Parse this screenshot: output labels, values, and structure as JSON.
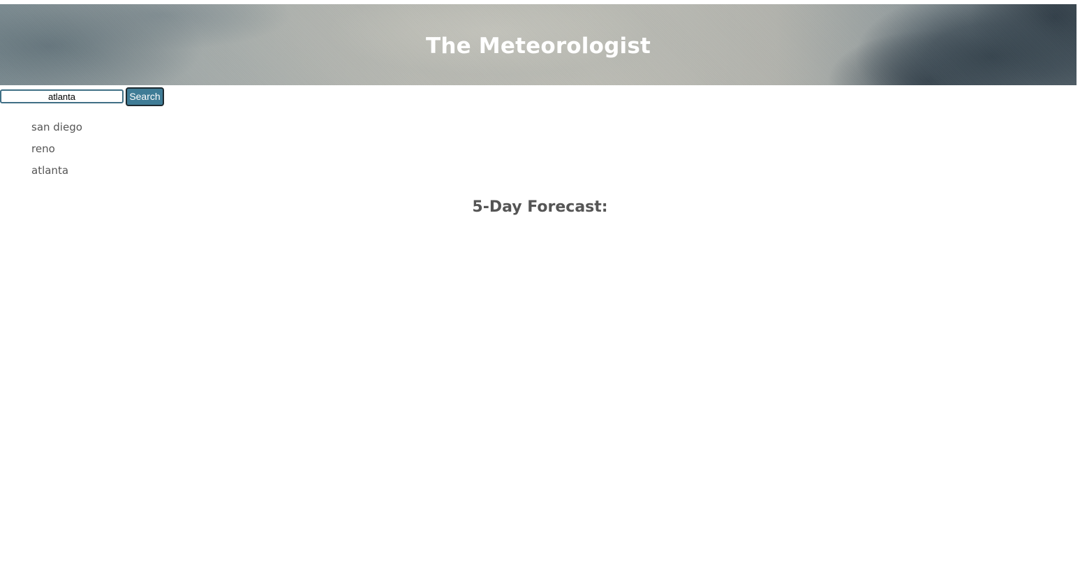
{
  "header": {
    "title": "The Meteorologist"
  },
  "search": {
    "value": "atlanta",
    "button_label": "Search"
  },
  "history": {
    "items": [
      {
        "label": "san diego"
      },
      {
        "label": "reno"
      },
      {
        "label": "atlanta"
      }
    ]
  },
  "forecast": {
    "heading": "5-Day Forecast:"
  },
  "colors": {
    "button_bg": "#3f7c96",
    "heading_text": "#555555",
    "title_text": "#ffffff"
  }
}
